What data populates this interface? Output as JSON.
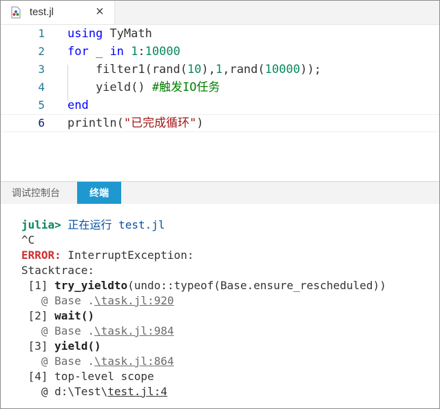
{
  "tab": {
    "title": "test.jl",
    "close_label": "×"
  },
  "editor": {
    "lines": [
      {
        "number": "1",
        "parts": [
          {
            "t": "using",
            "c": "kw"
          },
          {
            "t": " TyMath",
            "c": ""
          }
        ]
      },
      {
        "number": "2",
        "parts": [
          {
            "t": "for",
            "c": "kw"
          },
          {
            "t": " _ ",
            "c": ""
          },
          {
            "t": "in",
            "c": "kw"
          },
          {
            "t": " ",
            "c": ""
          },
          {
            "t": "1",
            "c": "num"
          },
          {
            "t": ":",
            "c": ""
          },
          {
            "t": "10000",
            "c": "num"
          }
        ]
      },
      {
        "number": "3",
        "parts": [
          {
            "t": "    filter1(rand(",
            "c": ""
          },
          {
            "t": "10",
            "c": "num"
          },
          {
            "t": "),",
            "c": ""
          },
          {
            "t": "1",
            "c": "num"
          },
          {
            "t": ",rand(",
            "c": ""
          },
          {
            "t": "10000",
            "c": "num"
          },
          {
            "t": "));",
            "c": ""
          }
        ]
      },
      {
        "number": "4",
        "parts": [
          {
            "t": "    yield() ",
            "c": ""
          },
          {
            "t": "#触发IO任务",
            "c": "cmt"
          }
        ]
      },
      {
        "number": "5",
        "parts": [
          {
            "t": "end",
            "c": "kw"
          }
        ]
      },
      {
        "number": "6",
        "parts": [
          {
            "t": "println(",
            "c": ""
          },
          {
            "t": "\"已完成循环\"",
            "c": "str"
          },
          {
            "t": ")",
            "c": ""
          }
        ]
      }
    ]
  },
  "panel": {
    "debug_tab": "调试控制台",
    "terminal_tab": "终端"
  },
  "terminal": {
    "prompt": "julia>",
    "run_text": " 正在运行 test.jl",
    "ctrl_c": "^C",
    "error_label": "ERROR:",
    "error_text": " InterruptException:",
    "stacktrace": "Stacktrace:",
    "frames": [
      {
        "idx": " [1] ",
        "func": "try_yieldto",
        "args": "(undo::typeof(Base.ensure_rescheduled))",
        "at": "   @ Base .",
        "file": "\\task.jl:920"
      },
      {
        "idx": " [2] ",
        "func": "wait()",
        "args": "",
        "at": "   @ Base .",
        "file": "\\task.jl:984"
      },
      {
        "idx": " [3] ",
        "func": "yield()",
        "args": "",
        "at": "   @ Base .",
        "file": "\\task.jl:864"
      },
      {
        "idx": " [4] ",
        "func": "",
        "args": "top-level scope",
        "at": "   @ d:\\Test\\",
        "file": "test.jl:4"
      }
    ]
  }
}
